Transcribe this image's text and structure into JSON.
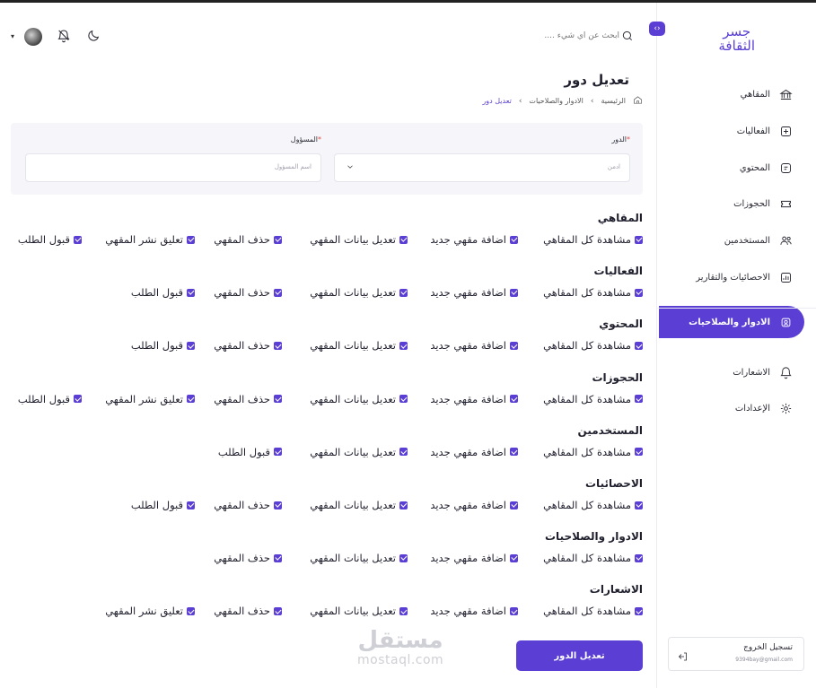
{
  "app": {
    "logo_line1": "جسر",
    "logo_line2": "الثقافة"
  },
  "header": {
    "search_placeholder": "ابحث عن أي شيء ....",
    "icons": [
      "search-icon",
      "moon-icon",
      "bell-icon",
      "avatar",
      "chevron-down-icon"
    ]
  },
  "sidebar": {
    "items": [
      {
        "label": "المقاهي",
        "icon": "bank-icon"
      },
      {
        "label": "الفعاليات",
        "icon": "grid-icon"
      },
      {
        "label": "المحتوي",
        "icon": "content-icon"
      },
      {
        "label": "الحجوزات",
        "icon": "ticket-icon"
      },
      {
        "label": "المستخدمين",
        "icon": "users-icon"
      },
      {
        "label": "الاحصائيات والتقارير",
        "icon": "chart-icon"
      },
      {
        "label": "الادوار والصلاحيات",
        "icon": "roles-icon",
        "active": true
      },
      {
        "label": "الاشعارات",
        "icon": "bell-icon"
      },
      {
        "label": "الإعدادات",
        "icon": "gear-icon"
      }
    ],
    "logout": {
      "label": "تسجيل الخروج",
      "email": "9394bay@gmail.com"
    }
  },
  "page": {
    "title": "تعديل دور",
    "breadcrumb": [
      "الرئيسية",
      "الادوار والصلاحيات",
      "تعديل دور"
    ]
  },
  "form": {
    "role_label": "الدور",
    "role_value": "ادمن",
    "owner_label": "المسؤول",
    "owner_placeholder": "اسم المسؤول",
    "required_mark": "*"
  },
  "sections": [
    {
      "title": "المقاهي",
      "perms": [
        "مشاهدة كل المقاهي",
        "اضافة مقهي جديد",
        "تعديل بيانات المقهي",
        "حذف المقهي",
        "تعليق نشر المقهي",
        "قبول الطلب"
      ]
    },
    {
      "title": "الفعاليات",
      "perms": [
        "مشاهدة كل المقاهي",
        "اضافة مقهي جديد",
        "تعديل بيانات المقهي",
        "حذف المقهي",
        "قبول الطلب"
      ]
    },
    {
      "title": "المحتوي",
      "perms": [
        "مشاهدة كل المقاهي",
        "اضافة مقهي جديد",
        "تعديل بيانات المقهي",
        "حذف المقهي",
        "قبول الطلب"
      ]
    },
    {
      "title": "الحجوزات",
      "perms": [
        "مشاهدة كل المقاهي",
        "اضافة مقهي جديد",
        "تعديل بيانات المقهي",
        "حذف المقهي",
        "تعليق نشر المقهي",
        "قبول الطلب"
      ]
    },
    {
      "title": "المستخدمين",
      "perms": [
        "مشاهدة كل المقاهي",
        "اضافة مقهي جديد",
        "تعديل بيانات المقهي",
        "قبول الطلب"
      ]
    },
    {
      "title": "الاحصائيات",
      "perms": [
        "مشاهدة كل المقاهي",
        "اضافة مقهي جديد",
        "تعديل بيانات المقهي",
        "حذف المقهي",
        "قبول الطلب"
      ]
    },
    {
      "title": "الادوار والصلاحيات",
      "perms": [
        "مشاهدة كل المقاهي",
        "اضافة مقهي جديد",
        "تعديل بيانات المقهي",
        "حذف المقهي"
      ]
    },
    {
      "title": "الاشعارات",
      "perms": [
        "مشاهدة كل المقاهي",
        "اضافة مقهي جديد",
        "تعديل بيانات المقهي",
        "حذف المقهي",
        "تعليق نشر المقهي"
      ]
    }
  ],
  "submit_label": "تعديل الدور",
  "watermark": {
    "arabic": "مستقل",
    "latin": "mostaql.com"
  },
  "colors": {
    "accent": "#5b3fd4",
    "card": "#f6f6fa"
  }
}
